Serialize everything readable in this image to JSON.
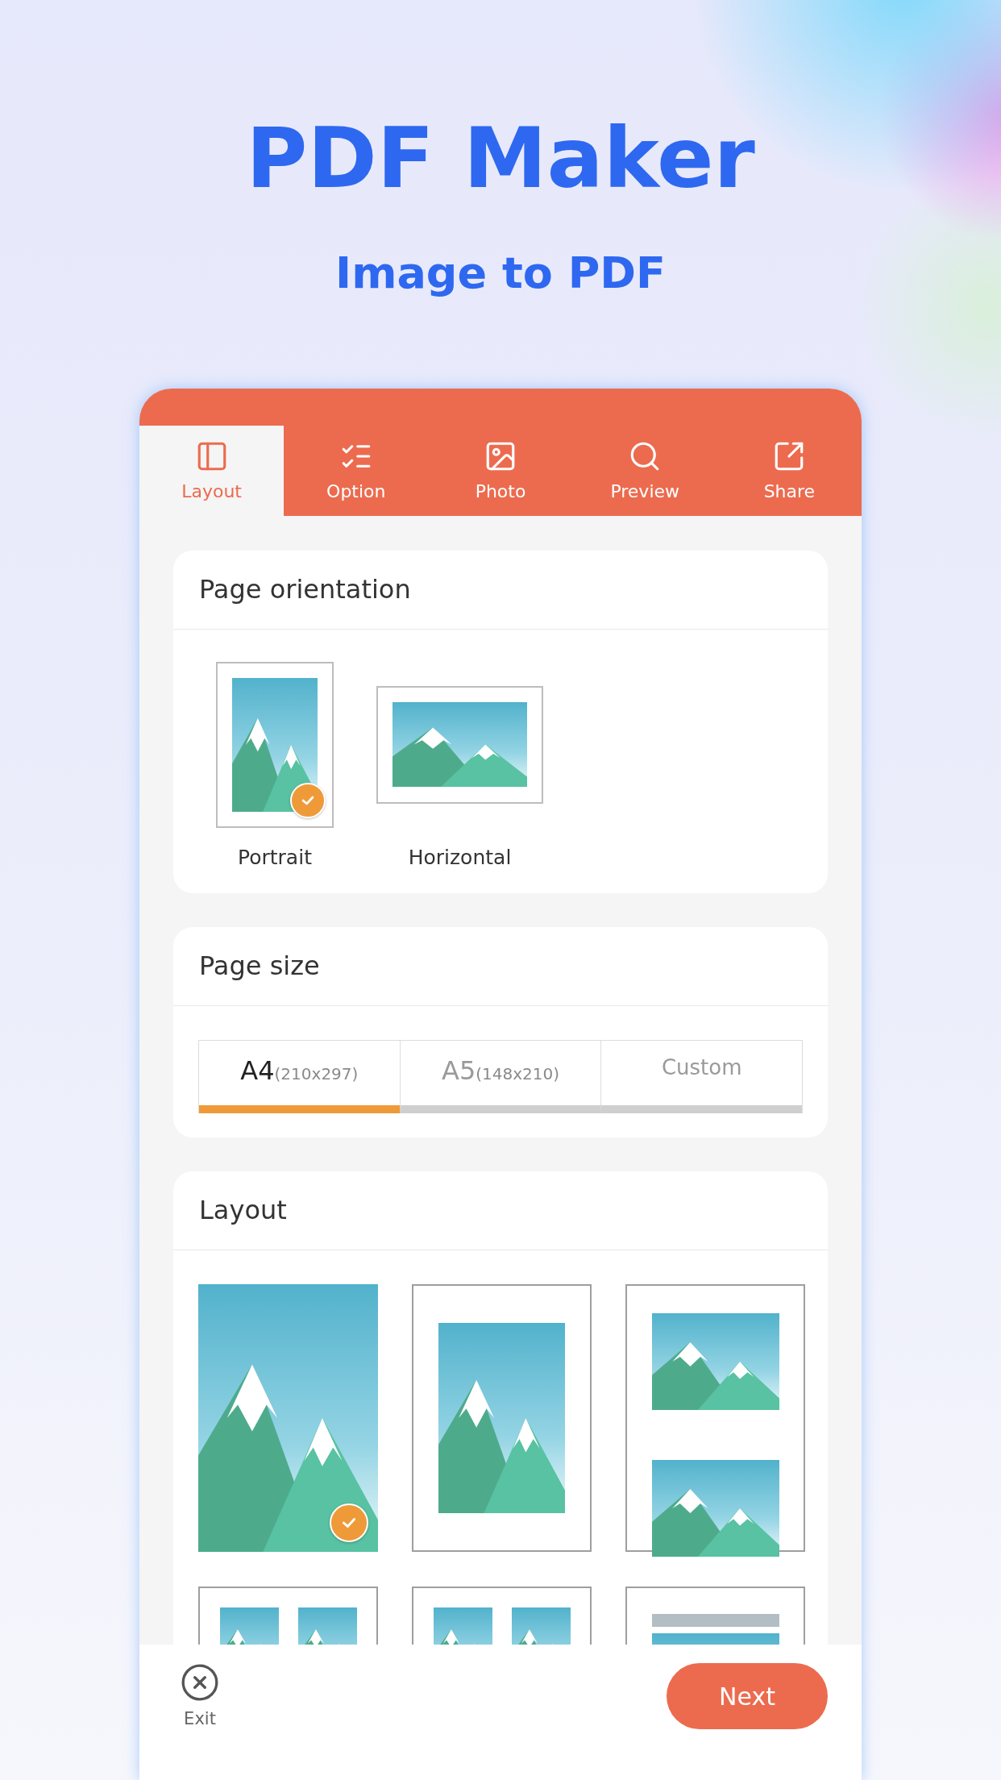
{
  "hero": {
    "title": "PDF Maker",
    "subtitle": "Image to PDF"
  },
  "tabs": [
    {
      "label": "Layout",
      "selected": true
    },
    {
      "label": "Option",
      "selected": false
    },
    {
      "label": "Photo",
      "selected": false
    },
    {
      "label": "Preview",
      "selected": false
    },
    {
      "label": "Share",
      "selected": false
    }
  ],
  "orientation": {
    "title": "Page orientation",
    "options": [
      {
        "kind": "portrait",
        "label": "Portrait",
        "selected": true
      },
      {
        "kind": "landscape",
        "label": "Horizontal",
        "selected": false
      }
    ]
  },
  "page_size": {
    "title": "Page size",
    "options": [
      {
        "label": "A4",
        "detail": "(210x297)",
        "selected": true
      },
      {
        "label": "A5",
        "detail": "(148x210)",
        "selected": false
      },
      {
        "label": "Custom",
        "selected": false
      }
    ]
  },
  "layout": {
    "title": "Layout",
    "options": [
      {
        "kind": "full",
        "selected": true
      },
      {
        "kind": "single",
        "selected": false
      },
      {
        "kind": "stacked",
        "selected": false
      },
      {
        "kind": "grid"
      },
      {
        "kind": "grid"
      },
      {
        "kind": "titled"
      }
    ]
  },
  "footer": {
    "exit": "Exit",
    "next": "Next"
  }
}
